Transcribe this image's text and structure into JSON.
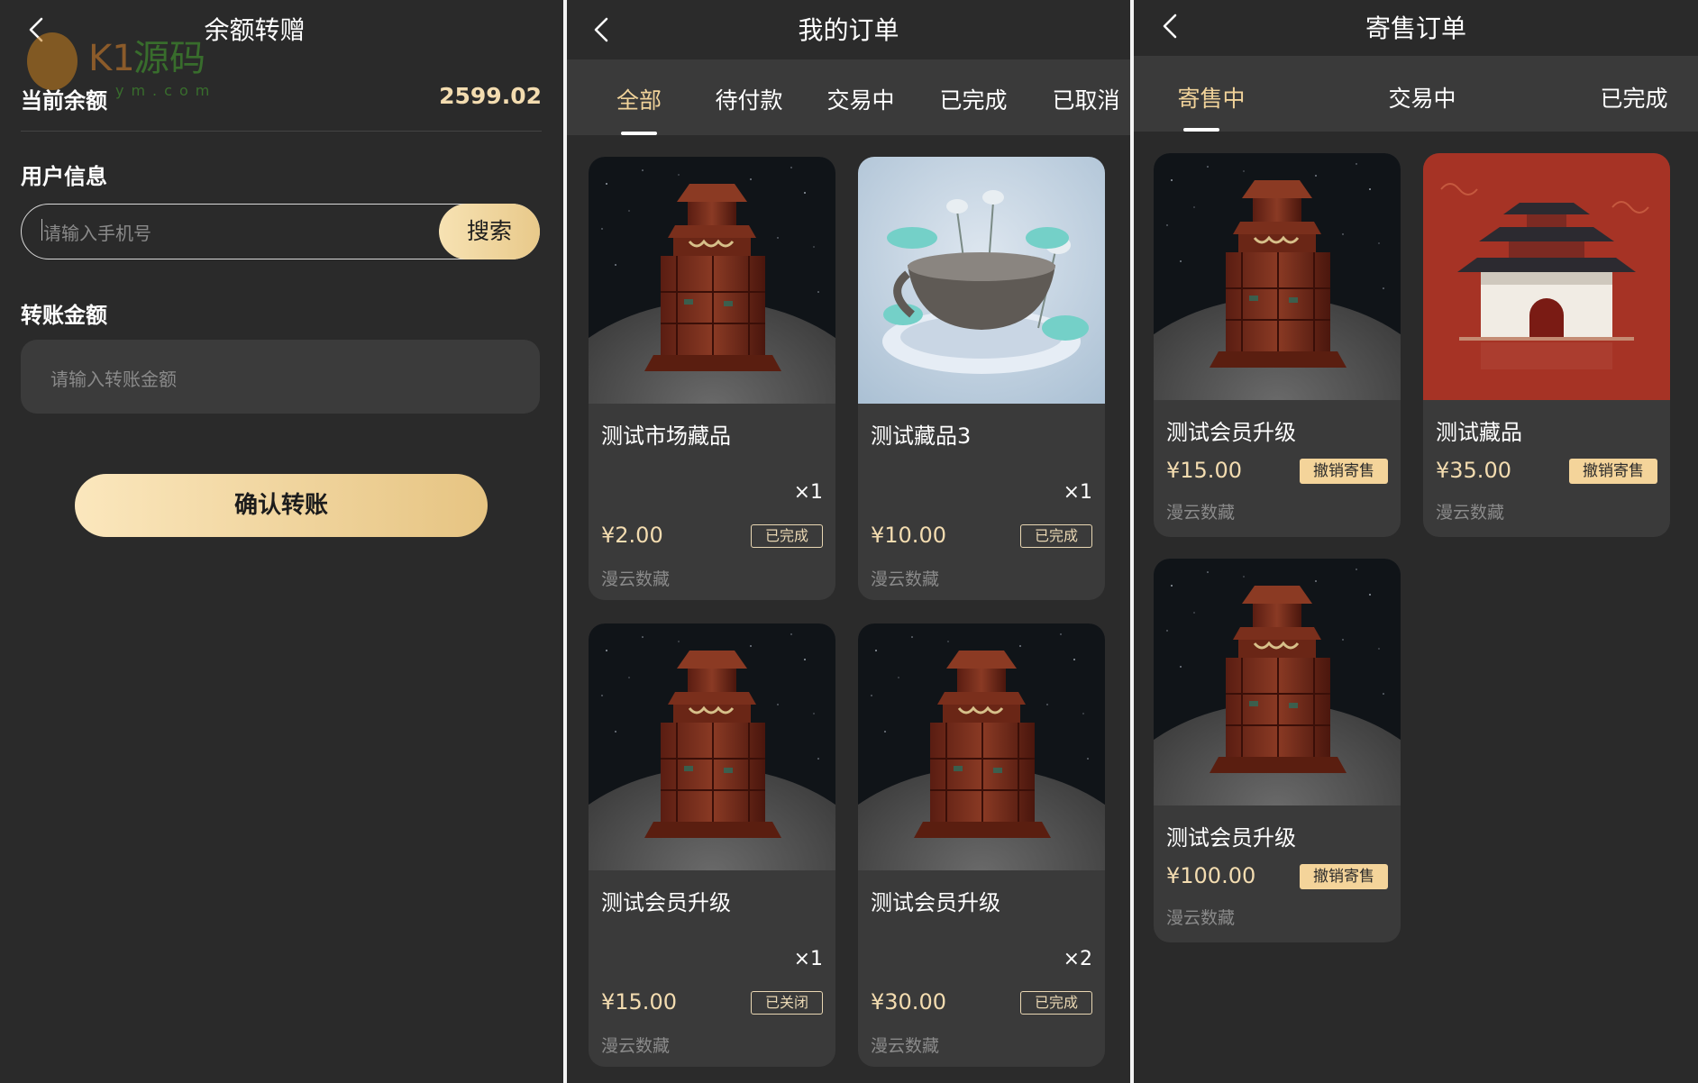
{
  "transfer_page": {
    "title": "余额转赠",
    "balance_label": "当前余额",
    "balance_value": "2599.02",
    "user_info_label": "用户信息",
    "phone_placeholder": "请输入手机号",
    "search_label": "搜索",
    "amount_label": "转账金额",
    "amount_placeholder": "请输入转账金额",
    "confirm_label": "确认转账",
    "watermark": "K1源码 ym.com"
  },
  "orders_page": {
    "title": "我的订单",
    "tabs": [
      "全部",
      "待付款",
      "交易中",
      "已完成",
      "已取消"
    ],
    "active_tab": "全部",
    "orders": [
      {
        "name": "测试市场藏品",
        "qty": "×1",
        "price": "¥2.00",
        "status": "已完成",
        "brand": "漫云数藏",
        "image": "pavilion-moon"
      },
      {
        "name": "测试藏品3",
        "qty": "×1",
        "price": "¥10.00",
        "status": "已完成",
        "brand": "漫云数藏",
        "image": "lotus-bowl"
      },
      {
        "name": "测试会员升级",
        "qty": "×1",
        "price": "¥15.00",
        "status": "已关闭",
        "brand": "漫云数藏",
        "image": "pavilion-moon"
      },
      {
        "name": "测试会员升级",
        "qty": "×2",
        "price": "¥30.00",
        "status": "已完成",
        "brand": "漫云数藏",
        "image": "pavilion-moon"
      }
    ]
  },
  "consign_page": {
    "title": "寄售订单",
    "tabs": [
      "寄售中",
      "交易中",
      "已完成"
    ],
    "active_tab": "寄售中",
    "items": [
      {
        "name": "测试会员升级",
        "price": "¥15.00",
        "action": "撤销寄售",
        "brand": "漫云数藏",
        "image": "pavilion-moon"
      },
      {
        "name": "测试藏品",
        "price": "¥35.00",
        "action": "撤销寄售",
        "brand": "漫云数藏",
        "image": "red-palace-gate"
      },
      {
        "name": "测试会员升级",
        "price": "¥100.00",
        "action": "撤销寄售",
        "brand": "漫云数藏",
        "image": "pavilion-moon"
      }
    ]
  },
  "colors": {
    "background": "#2a2a2a",
    "card": "#3a3a3a",
    "accent_gold": "#f3dcb0",
    "button_gold": "#e8c98a",
    "muted_text": "#8a8a8a"
  },
  "icons": [
    "back-chevron-icon"
  ]
}
